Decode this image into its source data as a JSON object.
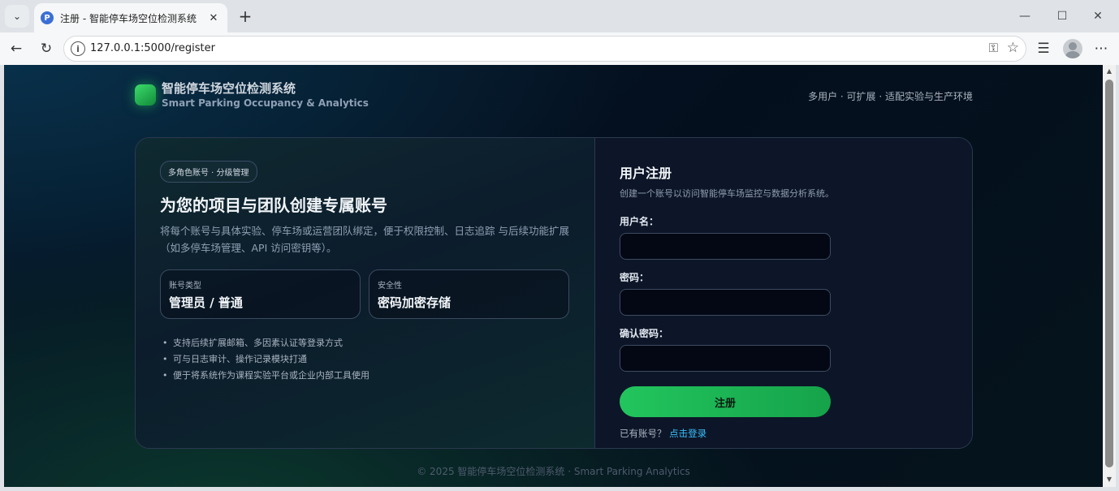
{
  "browser": {
    "tab_title": "注册 - 智能停车场空位检测系统",
    "tab_favicon_letter": "P",
    "url": "127.0.0.1:5000/register"
  },
  "header": {
    "brand_title": "智能停车场空位检测系统",
    "brand_subtitle": "Smart Parking Occupancy & Analytics",
    "tagline": "多用户 · 可扩展 · 适配实验与生产环境"
  },
  "intro": {
    "pill": "多角色账号 · 分级管理",
    "title": "为您的项目与团队创建专属账号",
    "description": "将每个账号与具体实验、停车场或运营团队绑定，便于权限控制、日志追踪 与后续功能扩展（如多停车场管理、API 访问密钥等）。",
    "cards": [
      {
        "label": "账号类型",
        "value": "管理员 / 普通"
      },
      {
        "label": "安全性",
        "value": "密码加密存储"
      }
    ],
    "features": [
      "支持后续扩展邮箱、多因素认证等登录方式",
      "可与日志审计、操作记录模块打通",
      "便于将系统作为课程实验平台或企业内部工具使用"
    ]
  },
  "form": {
    "title": "用户注册",
    "subtitle": "创建一个账号以访问智能停车场监控与数据分析系统。",
    "username_label": "用户名：",
    "password_label": "密码：",
    "confirm_label": "确认密码：",
    "submit_label": "注册",
    "login_prompt": "已有账号？",
    "login_link": "点击登录"
  },
  "footer": {
    "text": "© 2025 智能停车场空位检测系统 · Smart Parking Analytics"
  },
  "colors": {
    "accent": "#22c55e",
    "link": "#38bdf8",
    "background": "#061a2a"
  }
}
